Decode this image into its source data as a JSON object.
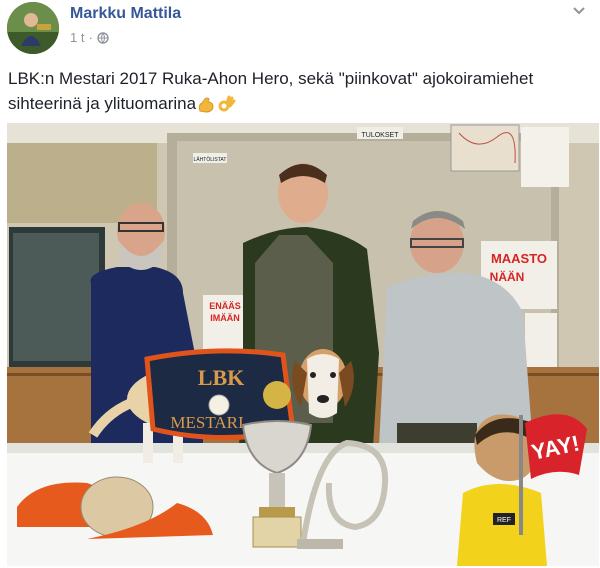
{
  "post": {
    "author": "Markku Mattila",
    "timestamp": "1 t",
    "separator": "·",
    "privacy_icon": "globe-icon",
    "options_icon": "chevron-down-icon",
    "text": "LBK:n Mestari 2017 Ruka-Ahon Hero, sekä \"piinkovat\" ajokoiramiehet sihteerinä ja ylituomarina",
    "emojis": [
      "flexed-biceps-icon",
      "ok-hand-icon"
    ]
  },
  "photo": {
    "blanket_text_top": "LBK",
    "blanket_text_bottom": "MESTARI",
    "sign_tulokset": "TULOKSET",
    "sign_lahtolistat": "LÄHTÖLISTAT",
    "poster_text": "MAASTO",
    "poster_sub": "NÄÄN",
    "poster2_text": "ENÄÄS",
    "poster2_sub": "IMÄÄN",
    "sticker_text": "YAY!",
    "referee_badge": "REF"
  },
  "colors": {
    "author_link": "#365899",
    "meta_gray": "#90949c",
    "blanket": "#1c2a44",
    "blanket_trim": "#e0541c",
    "yay_red": "#d8232a"
  }
}
